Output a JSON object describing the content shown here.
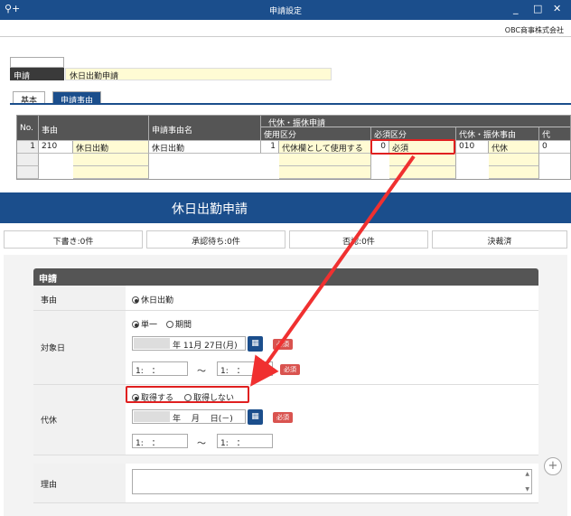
{
  "window": {
    "title": "申請設定",
    "company": "OBC商事株式会社",
    "logo": "⚲+",
    "minimize": "_",
    "maximize": "□",
    "close": "✕"
  },
  "application": {
    "label": "申請",
    "value": "休日出勤申請"
  },
  "tabs": [
    "基本",
    "申請事由"
  ],
  "grid": {
    "headers": {
      "no": "No.",
      "reason": "事由",
      "reason_name": "申請事由名",
      "group": "代休・振休申請",
      "usage": "使用区分",
      "required": "必須区分",
      "substitute_reason": "代休・振休事由",
      "cut": "代"
    },
    "row": {
      "no": "1",
      "code": "210",
      "reason": "休日出勤",
      "reason_name": "休日出勤",
      "usage_code": "1",
      "usage": "代休欄として使用する",
      "required_code": "0",
      "required": "必須",
      "sub_code": "010",
      "sub_name": "代休",
      "cut": "0"
    }
  },
  "banner": {
    "title": "休日出勤申請"
  },
  "status_buttons": [
    "下書き:0件",
    "承認待ち:0件",
    "否認:0件",
    "決裁済"
  ],
  "form": {
    "section": "申請",
    "reason_label": "事由",
    "reason_value": "休日出勤",
    "target_label": "対象日",
    "single": "単一",
    "period": "期間",
    "date_value": "年 11月 27日(月)",
    "time_start": "1:　：",
    "time_end": "1:　：",
    "tilde": "～",
    "required": "必須",
    "daikyu_label": "代休",
    "acquire": "取得する",
    "not_acquire": "取得しない",
    "daikyu_date": "年　 月　 日(－)",
    "daikyu_time_start": "1:　：",
    "daikyu_time_end": "1:　：",
    "riyu_label": "理由"
  },
  "icons": {
    "calendar": "▦",
    "plus": "+",
    "scroll_up": "▲",
    "scroll_down": "▼"
  },
  "colors": {
    "accent": "#1b4e8c",
    "required": "#d9534f",
    "highlight": "#e02020",
    "yellow": "#fffbd4"
  }
}
